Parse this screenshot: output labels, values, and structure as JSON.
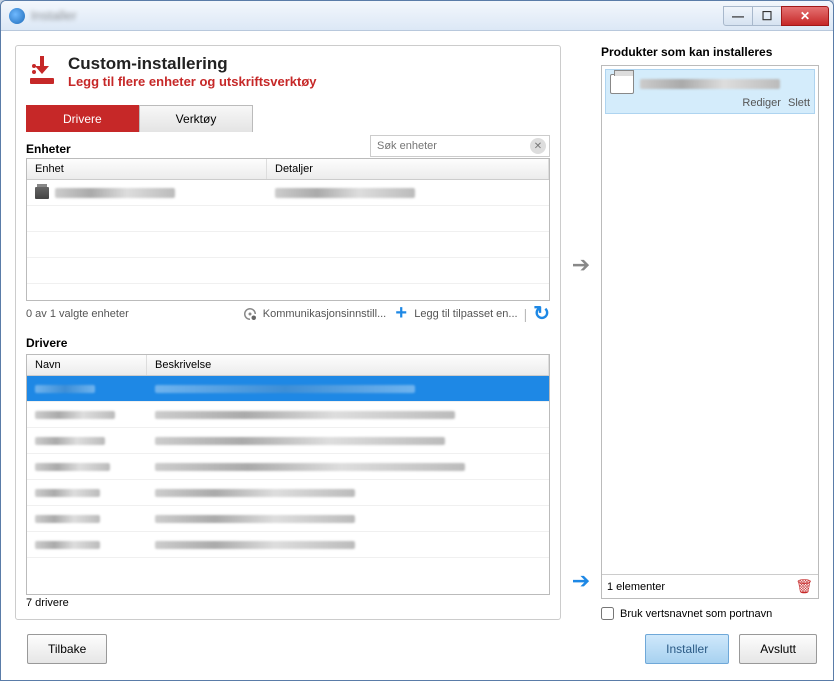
{
  "window": {
    "title": "Installer"
  },
  "header": {
    "title": "Custom-installering",
    "subtitle": "Legg til flere enheter og utskriftsverktøy"
  },
  "tabs": {
    "drivers": "Drivere",
    "tools": "Verktøy"
  },
  "devices": {
    "section_label": "Enheter",
    "search_placeholder": "Søk enheter",
    "columns": {
      "device": "Enhet",
      "details": "Detaljer"
    },
    "status": "0 av 1 valgte enheter",
    "comm_settings": "Kommunikasjonsinnstill...",
    "add_custom": "Legg til tilpasset en..."
  },
  "drivers": {
    "section_label": "Drivere",
    "columns": {
      "name": "Navn",
      "description": "Beskrivelse"
    },
    "count_label": "7 drivere",
    "total_rows": 7
  },
  "right": {
    "title": "Produkter som kan installeres",
    "edit": "Rediger",
    "delete": "Slett",
    "elements_label": "1 elementer",
    "hostname_checkbox": "Bruk vertsnavnet som portnavn"
  },
  "buttons": {
    "back": "Tilbake",
    "install": "Installer",
    "exit": "Avslutt"
  }
}
